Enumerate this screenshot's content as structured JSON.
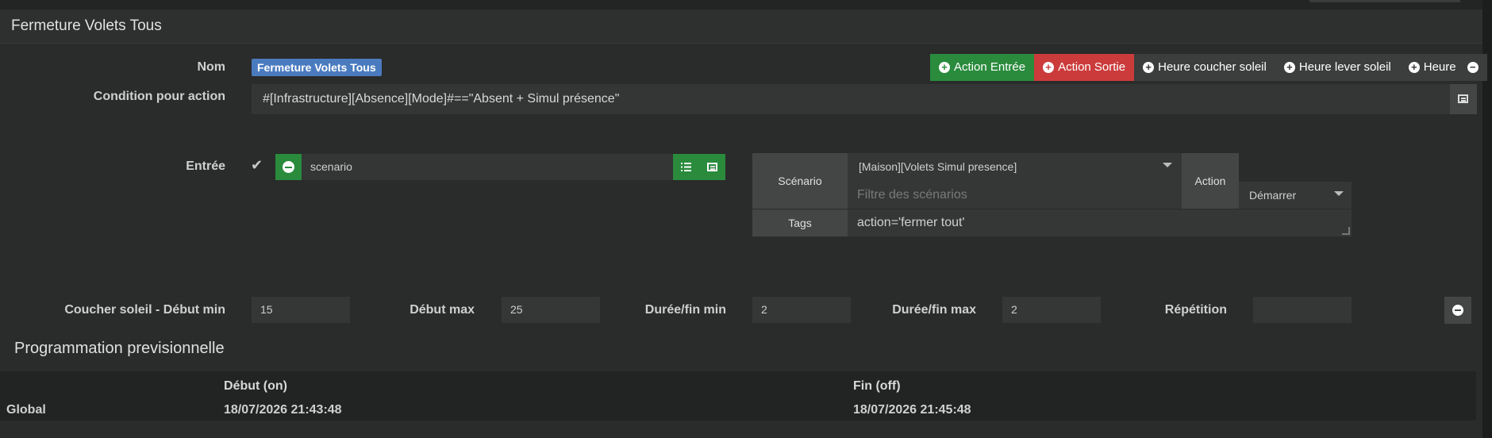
{
  "panel": {
    "title": "Fermeture Volets Tous"
  },
  "form": {
    "nom_label": "Nom",
    "nom_value": "Fermeture Volets Tous",
    "condition_label": "Condition pour action",
    "condition_value": "#[Infrastructure][Absence][Mode]#==\"Absent + Simul présence\"",
    "entree_label": "Entrée",
    "entree_value": "scenario"
  },
  "toolbar": {
    "buttons": [
      {
        "label": "Action Entrée"
      },
      {
        "label": "Action Sortie"
      },
      {
        "label": "Heure coucher soleil"
      },
      {
        "label": "Heure lever soleil"
      },
      {
        "label": "Heure"
      }
    ]
  },
  "scenario_box": {
    "scenario_label": "Scénario",
    "scenario_value": "[Maison][Volets Simul presence]",
    "filter_placeholder": "Filtre des scénarios",
    "action_label": "Action",
    "action_value": "Démarrer",
    "tags_label": "Tags",
    "tags_value": "action='fermer tout'"
  },
  "timing": {
    "coucher_label": "Coucher soleil - Début min",
    "coucher_value": "15",
    "debut_max_label": "Début max",
    "debut_max_value": "25",
    "duree_min_label": "Durée/fin min",
    "duree_min_value": "2",
    "duree_max_label": "Durée/fin max",
    "duree_max_value": "2",
    "repetition_label": "Répétition",
    "repetition_value": ""
  },
  "programmation": {
    "title": "Programmation previsionnelle",
    "col_start": "Début (on)",
    "col_end": "Fin (off)",
    "row_label": "Global",
    "row_start": "18/07/2026 21:43:48",
    "row_end": "18/07/2026 21:45:48"
  },
  "colors": {
    "accent_green": "#2a8b3d",
    "accent_red": "#cc3b3b",
    "badge_blue": "#4a7bbf",
    "background": "#2a2b2b"
  }
}
